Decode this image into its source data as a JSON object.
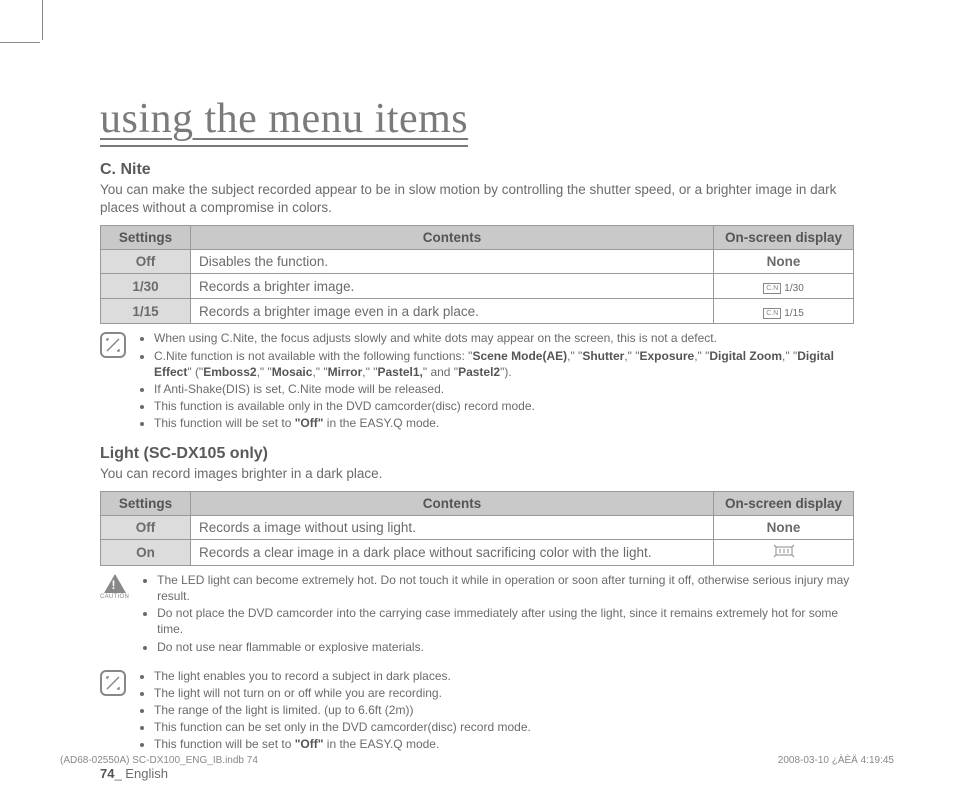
{
  "page_title": "using the menu items",
  "section1": {
    "heading": "C. Nite",
    "intro": "You can make the subject recorded appear to be in slow motion by controlling the shutter speed, or a brighter image in dark places without a compromise in colors.",
    "headers": {
      "settings": "Settings",
      "contents": "Contents",
      "display": "On-screen display"
    },
    "rows": [
      {
        "setting": "Off",
        "content": "Disables the function.",
        "display": "None",
        "display_type": "text"
      },
      {
        "setting": "1/30",
        "content": "Records a brighter image.",
        "display": "1/30",
        "display_type": "icon"
      },
      {
        "setting": "1/15",
        "content": "Records a brighter image even in a dark place.",
        "display": "1/15",
        "display_type": "icon"
      }
    ],
    "notes": [
      "When using C.Nite, the focus adjusts slowly and white dots may appear on the screen, this is not a defect.",
      "C.Nite function is not available with the following functions: \"<b>Scene Mode(AE)</b>,\" \"<b>Shutter</b>,\" \"<b>Exposure</b>,\" \"<b>Digital Zoom</b>,\" \"<b>Digital Effect</b>\" (\"<b>Emboss2</b>,\" \"<b>Mosaic</b>,\" \"<b>Mirror</b>,\" \"<b>Pastel1,</b>\" and \"<b>Pastel2</b>\").",
      "If Anti-Shake(DIS) is set, C.Nite mode will be released.",
      "This function is available only in the DVD camcorder(disc) record mode.",
      "This function will be set to <b>\"Off\"</b> in the EASY.Q mode."
    ]
  },
  "section2": {
    "heading": "Light (SC-DX105 only)",
    "intro": "You can record images brighter in a dark place.",
    "headers": {
      "settings": "Settings",
      "contents": "Contents",
      "display": "On-screen display"
    },
    "rows": [
      {
        "setting": "Off",
        "content": "Records a image without using light.",
        "display": "None",
        "display_type": "text"
      },
      {
        "setting": "On",
        "content": "Records a clear image in a dark place without sacrificing color with the light.",
        "display": "",
        "display_type": "light-icon"
      }
    ],
    "cautions": [
      "The LED light can become extremely hot. Do not touch it while in operation or soon after turning it off, otherwise serious injury may result.",
      "Do not place the DVD camcorder into the carrying case immediately after using the light, since it remains extremely hot for some time.",
      "Do not use near flammable or explosive materials."
    ],
    "caution_label": "CAUTION",
    "notes": [
      "The light enables you to record a subject in dark places.",
      "The light will not turn on or off while you are recording.",
      "The range of the light is limited. (up to 6.6ft (2m))",
      "This function can be set only in the DVD camcorder(disc) record mode.",
      "This function will be set to <b>\"Off\"</b> in the EASY.Q mode."
    ]
  },
  "page_footer": {
    "num": "74",
    "lang": "_ English"
  },
  "print_footer": {
    "left": "(AD68-02550A) SC-DX100_ENG_IB.indb   74",
    "right": "2008-03-10   ¿ÀÈÄ 4:19:45"
  },
  "icon_cn_label": "C.N"
}
